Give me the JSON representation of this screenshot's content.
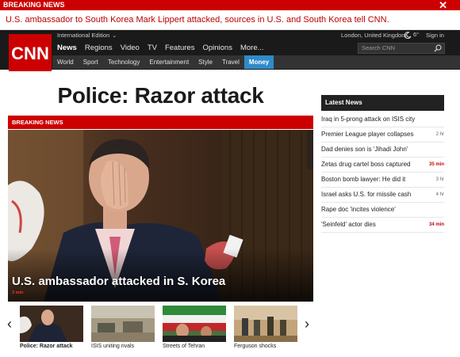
{
  "banner": {
    "label": "BREAKING NEWS",
    "close_glyph": "✕",
    "message": "U.S. ambassador to South Korea Mark Lippert attacked, sources in U.S. and South Korea tell CNN."
  },
  "header": {
    "logo_text": "CNN",
    "edition": "International Edition",
    "location": "London, United Kingdom",
    "temperature": "6°",
    "sign_in": "Sign in",
    "search_placeholder": "Search CNN",
    "nav_main": [
      "News",
      "Regions",
      "Video",
      "TV",
      "Features",
      "Opinions",
      "More..."
    ],
    "nav_sub": [
      "World",
      "Sport",
      "Technology",
      "Entertainment",
      "Style",
      "Travel",
      "Money"
    ]
  },
  "main": {
    "headline": "Police: Razor attack",
    "hero_label": "BREAKING NEWS",
    "hero_caption": "U.S. ambassador attacked in S. Korea",
    "hero_time": "3 min",
    "thumbnails": [
      {
        "label": "Police: Razor attack"
      },
      {
        "label": "ISIS uniting rivals"
      },
      {
        "label": "Streets of Tehran"
      },
      {
        "label": "Ferguson shocks"
      }
    ],
    "prev_glyph": "‹",
    "next_glyph": "›"
  },
  "latest": {
    "title": "Latest News",
    "items": [
      {
        "text": "Iraq in 5-prong attack on ISIS city",
        "time": ""
      },
      {
        "text": "Premier League player collapses",
        "time": "2 hr"
      },
      {
        "text": "Dad denies son is 'Jihadi John'",
        "time": ""
      },
      {
        "text": "Zetas drug cartel boss captured",
        "time": "35 min"
      },
      {
        "text": "Boston bomb lawyer: He did it",
        "time": "3 hr"
      },
      {
        "text": "Israel asks U.S. for missile cash",
        "time": "4 hr"
      },
      {
        "text": "Rape doc 'incites violence'",
        "time": ""
      },
      {
        "text": "'Seinfeld' actor dies",
        "time": "34 min"
      }
    ]
  },
  "colors": {
    "brand_red": "#cc0000",
    "header_dark": "#1a1a1a",
    "money_blue": "#2e8bc9"
  }
}
